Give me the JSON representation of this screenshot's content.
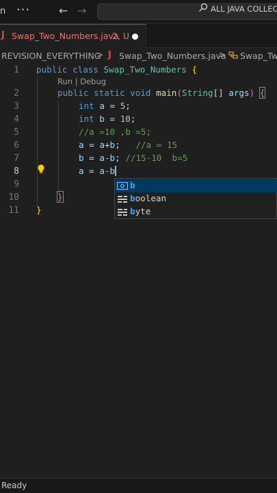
{
  "titlebar": {
    "menu_fragment": "n",
    "more_label": "···",
    "back_icon": "arrow-left-icon",
    "forward_icon": "arrow-right-icon",
    "search_icon": "search-icon",
    "search_text": "ALL JAVA COLLECT"
  },
  "tab": {
    "icon": "J",
    "name": "Swap_Two_Numbers.java",
    "status": "2, U",
    "modified_dot_color": "#ffffff"
  },
  "breadcrumb": {
    "folder": "REVISION_EVERYTHING",
    "sep": ">",
    "java_icon": "J",
    "file": "Swap_Two_Numbers.java",
    "symbol_icon": "class-symbol-icon",
    "symbol": "Swap_Two"
  },
  "editor": {
    "line_numbers": [
      "1",
      "2",
      "3",
      "4",
      "5",
      "6",
      "7",
      "8",
      "9",
      "10",
      "11"
    ],
    "active_line": "8",
    "codelens": "Run | Debug",
    "lines": {
      "l1_kw": "public class ",
      "l1_cls": "Swap_Two_Numbers",
      "l1_brace": " {",
      "l2_kw1": "public static void ",
      "l2_fn": "main",
      "l2_paren": "(",
      "l2_type": "String",
      "l2_brackets": "[] ",
      "l2_arg": "args",
      "l2_close": ") ",
      "l2_brace": "{",
      "l3_kw": "int ",
      "l3_var": "a",
      "l3_eq": " = ",
      "l3_num": "5",
      "l3_semi": ";",
      "l4_kw": "int ",
      "l4_var": "b",
      "l4_eq": " = ",
      "l4_num": "10",
      "l4_semi": ";",
      "l5_comment": "//a =10 ,b =5;",
      "l6_a": "a",
      "l6_eq": " = ",
      "l6_a2": "a",
      "l6_plus": "+",
      "l6_b": "b",
      "l6_semi": ";   ",
      "l6_comment": "//a = 15",
      "l7_b": "b",
      "l7_eq": " = ",
      "l7_a": "a",
      "l7_minus": "-",
      "l7_b2": "b",
      "l7_semi": "; ",
      "l7_comment": "//15-10  b=5",
      "l8_a": "a",
      "l8_eq": " = ",
      "l8_a2": "a",
      "l8_minus": "-",
      "l8_b": "b",
      "l10_brace": "}",
      "l11_brace": "}"
    }
  },
  "suggestions": [
    {
      "icon": "variable-icon",
      "match": "b",
      "rest": ""
    },
    {
      "icon": "keyword-icon",
      "match": "b",
      "rest": "oolean"
    },
    {
      "icon": "keyword-icon",
      "match": "b",
      "rest": "yte"
    }
  ],
  "status": {
    "text": "Ready"
  }
}
